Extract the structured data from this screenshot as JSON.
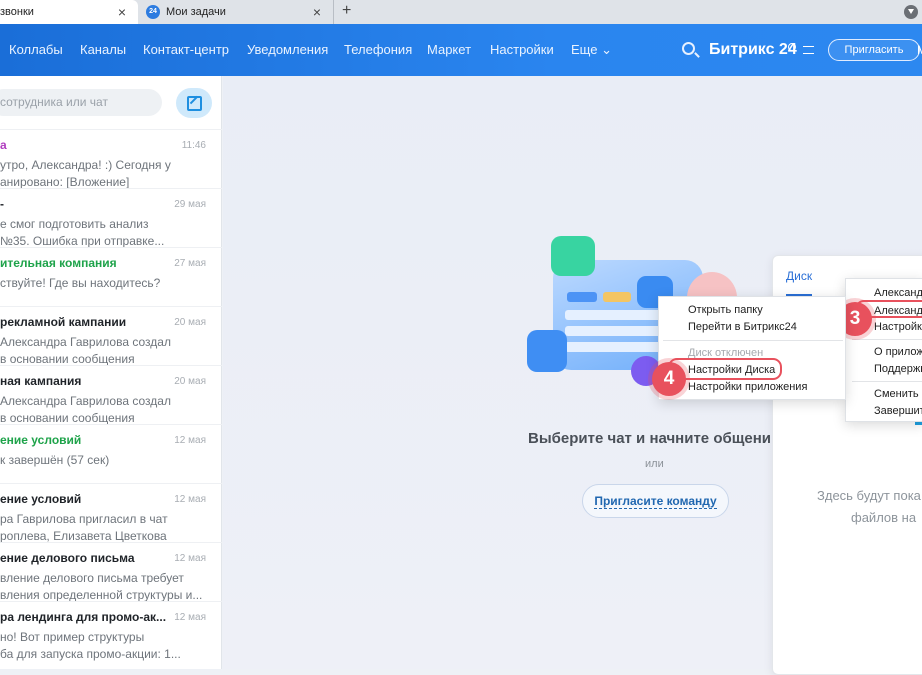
{
  "browser": {
    "tabs": [
      {
        "title": "звонки",
        "close": "×"
      },
      {
        "title": "Мои задачи",
        "close": "×",
        "favicon": "24"
      }
    ],
    "new_tab": "+"
  },
  "topnav": {
    "items": [
      "Коллабы",
      "Каналы",
      "Контакт-центр",
      "Уведомления",
      "Телефония",
      "Маркет",
      "Настройки",
      "Еще ⌄"
    ],
    "brand": "Битрикс 24",
    "invite_label": "Пригласить",
    "cut_label": "М"
  },
  "sidebar": {
    "search_placeholder": "сотрудника или чат",
    "chats": [
      {
        "title": "а",
        "time": "11:46",
        "lines": [
          "утро, Александра! :) Сегодня у",
          "анировано: [Вложение]"
        ],
        "color": "purple"
      },
      {
        "title": "-",
        "time": "29 мая",
        "lines": [
          "е смог подготовить анализ",
          "№35. Ошибка при отправке..."
        ],
        "color": "default"
      },
      {
        "title": "ительная компания",
        "time": "27 мая",
        "lines": [
          "ствуйте! Где вы находитесь?"
        ],
        "color": "green"
      },
      {
        "title": "рекламной кампании",
        "time": "20 мая",
        "lines": [
          "Александра Гаврилова создал",
          "в основании сообщения"
        ],
        "color": "default"
      },
      {
        "title": "ная кампания",
        "time": "20 мая",
        "lines": [
          "Александра Гаврилова создал",
          "в основании сообщения"
        ],
        "color": "default"
      },
      {
        "title": "ение условий",
        "time": "12 мая",
        "lines": [
          "к завершён (57 сек)"
        ],
        "color": "green"
      },
      {
        "title": "ение условий",
        "time": "12 мая",
        "lines": [
          "ра Гаврилова пригласил в чат",
          "роплева, Елизавета Цветкова"
        ],
        "color": "default"
      },
      {
        "title": "ение делового письма",
        "time": "12 мая",
        "lines": [
          "вление делового письма требует",
          "вления определенной структуры и..."
        ],
        "color": "default"
      },
      {
        "title": "ра лендинга для промо-ак...",
        "time": "12 мая",
        "lines": [
          "но! Вот пример структуры",
          "ба для запуска промо-акции: 1..."
        ],
        "color": "default"
      }
    ]
  },
  "main": {
    "empty_title": "Выберите чат и начните общени",
    "or": "или",
    "invite_team": "Пригласите команду"
  },
  "disk_window": {
    "title": "Диск",
    "empty_line1": "Здесь будут пока",
    "empty_line2": "файлов на"
  },
  "tray_menu": {
    "items": [
      {
        "label": "Открыть папку",
        "disabled": false
      },
      {
        "label": "Перейти в Битрикс24",
        "disabled": false
      },
      {
        "label": "Диск отключен",
        "disabled": true
      },
      {
        "label": "Настройки Диска",
        "disabled": false
      },
      {
        "label": "Настройки приложения",
        "disabled": false
      }
    ]
  },
  "account_menu": {
    "items": [
      "Александр",
      "Александр",
      "Настройки",
      "О приложе",
      "Поддержк",
      "Сменить п",
      "Завершить"
    ]
  },
  "annotations": {
    "step3": "3",
    "step4": "4"
  },
  "colors": {
    "nav": "#2a85ef",
    "accent": "#2067b0",
    "highlight": "#e8515d",
    "green": "#1ea34a",
    "purple": "#b03dbf"
  }
}
